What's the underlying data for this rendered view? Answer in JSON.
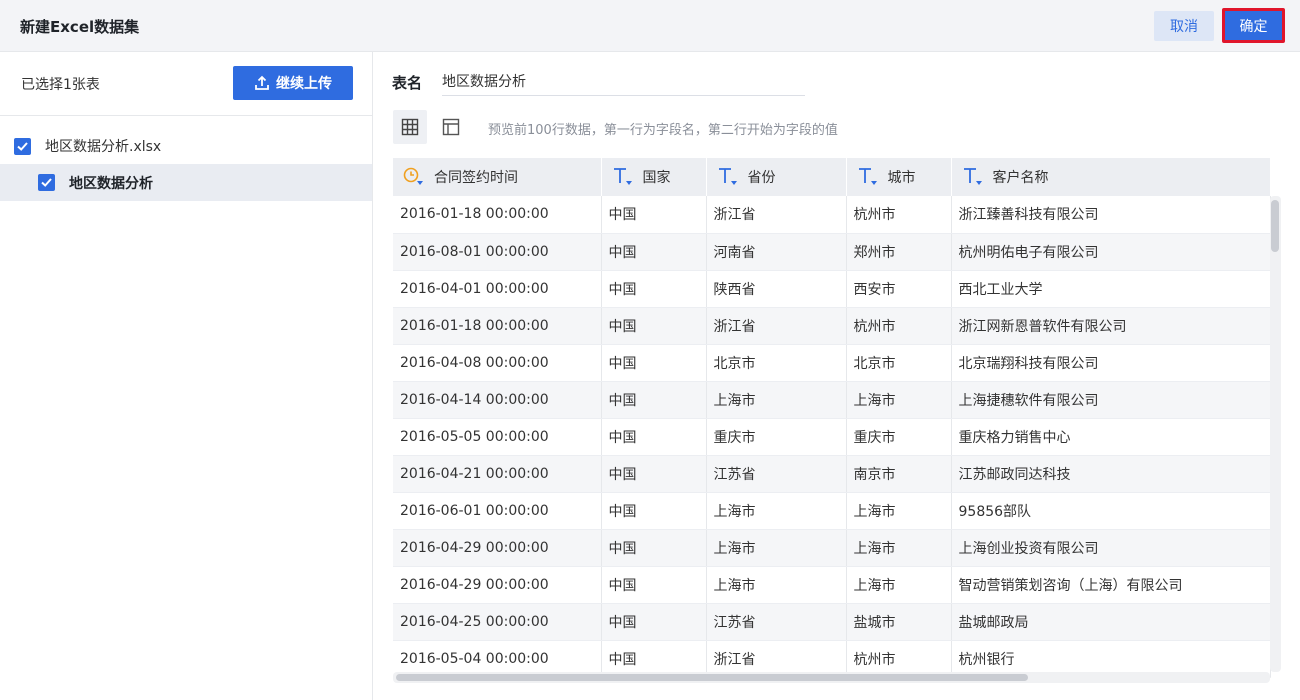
{
  "header": {
    "title": "新建Excel数据集",
    "cancel_label": "取消",
    "confirm_label": "确定"
  },
  "sidebar": {
    "selected_count": "已选择1张表",
    "upload_label": "继续上传",
    "file_name": "地区数据分析.xlsx",
    "sheet_name": "地区数据分析"
  },
  "main": {
    "name_label": "表名",
    "name_value": "地区数据分析",
    "hint": "预览前100行数据，第一行为字段名，第二行开始为字段的值"
  },
  "table": {
    "columns": [
      {
        "label": "合同签约时间",
        "type": "date"
      },
      {
        "label": "国家",
        "type": "text"
      },
      {
        "label": "省份",
        "type": "text"
      },
      {
        "label": "城市",
        "type": "text"
      },
      {
        "label": "客户名称",
        "type": "text"
      }
    ],
    "rows": [
      [
        "2016-01-18 00:00:00",
        "中国",
        "浙江省",
        "杭州市",
        "浙江臻善科技有限公司"
      ],
      [
        "2016-08-01 00:00:00",
        "中国",
        "河南省",
        "郑州市",
        "杭州明佑电子有限公司"
      ],
      [
        "2016-04-01 00:00:00",
        "中国",
        "陕西省",
        "西安市",
        "西北工业大学"
      ],
      [
        "2016-01-18 00:00:00",
        "中国",
        "浙江省",
        "杭州市",
        "浙江网新恩普软件有限公司"
      ],
      [
        "2016-04-08 00:00:00",
        "中国",
        "北京市",
        "北京市",
        "北京瑞翔科技有限公司"
      ],
      [
        "2016-04-14 00:00:00",
        "中国",
        "上海市",
        "上海市",
        "上海捷穗软件有限公司"
      ],
      [
        "2016-05-05 00:00:00",
        "中国",
        "重庆市",
        "重庆市",
        "重庆格力销售中心"
      ],
      [
        "2016-04-21 00:00:00",
        "中国",
        "江苏省",
        "南京市",
        "江苏邮政同达科技"
      ],
      [
        "2016-06-01 00:00:00",
        "中国",
        "上海市",
        "上海市",
        "95856部队"
      ],
      [
        "2016-04-29 00:00:00",
        "中国",
        "上海市",
        "上海市",
        "上海创业投资有限公司"
      ],
      [
        "2016-04-29 00:00:00",
        "中国",
        "上海市",
        "上海市",
        "智动营销策划咨询（上海）有限公司"
      ],
      [
        "2016-04-25 00:00:00",
        "中国",
        "江苏省",
        "盐城市",
        "盐城邮政局"
      ],
      [
        "2016-05-04 00:00:00",
        "中国",
        "浙江省",
        "杭州市",
        "杭州银行"
      ]
    ]
  },
  "colors": {
    "primary": "#2f6ce0",
    "highlight_border": "#e0152b",
    "date_icon": "#f0a020"
  }
}
